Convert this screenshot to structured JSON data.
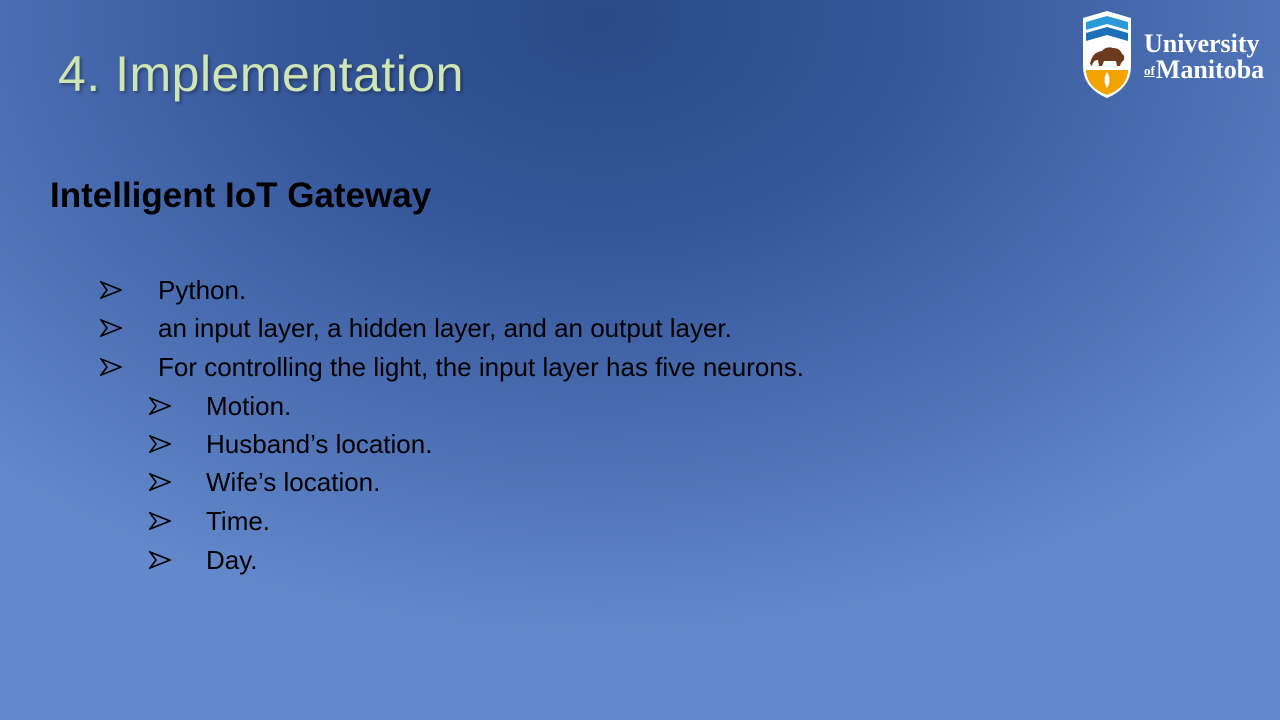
{
  "slide": {
    "title": "4. Implementation",
    "subtitle": "Intelligent IoT Gateway",
    "bullets": [
      {
        "level": 1,
        "text": "Python."
      },
      {
        "level": 1,
        "text": "an input layer, a hidden layer, and an output layer."
      },
      {
        "level": 1,
        "text": "For controlling the light, the input layer has five neurons."
      },
      {
        "level": 2,
        "text": "Motion."
      },
      {
        "level": 2,
        "text": "Husband’s location."
      },
      {
        "level": 2,
        "text": "Wife’s location."
      },
      {
        "level": 2,
        "text": "Time."
      },
      {
        "level": 2,
        "text": "Day."
      }
    ]
  },
  "logo": {
    "line1": "University",
    "of": "of",
    "line2": "Manitoba",
    "icon": "bison-crest-icon"
  },
  "colors": {
    "title": "#cfe6b4",
    "text": "#000000",
    "background_center": "#294a86",
    "background_edge": "#6389cc",
    "crest_blue": "#2a9bd8",
    "crest_brown": "#6b3a1f",
    "crest_gold": "#f2a300"
  }
}
